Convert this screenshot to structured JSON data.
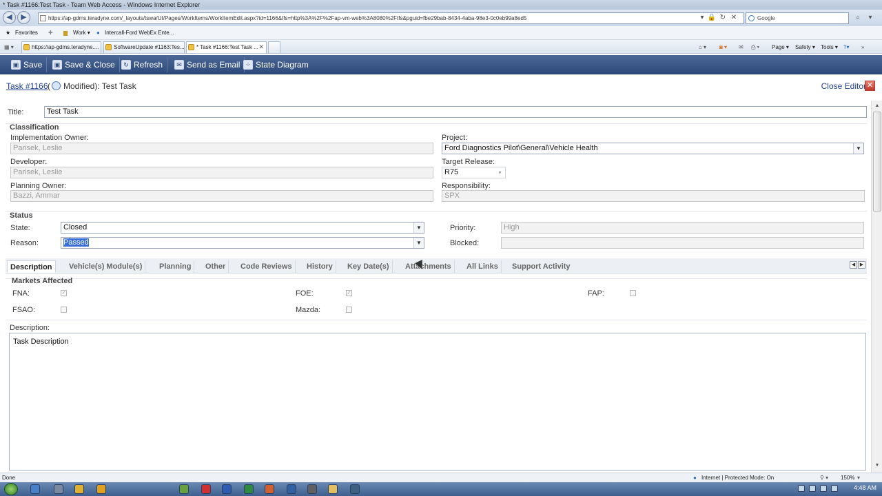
{
  "browser": {
    "window_title": "* Task #1166:Test Task - Team Web Access - Windows Internet Explorer",
    "address": "https://ap-gdms.teradyne.com/_layouts/tswa/UI/Pages/WorkItems/WorkItemEdit.aspx?id=1166&tfs=http%3A%2F%2Fap-vm-web%3A8080%2Ftfs&pguid=fbe29bab-8434-4aba-98e3-0c0eb99a8ed5",
    "search_placeholder": "Google",
    "favorites_label": "Favorites",
    "fav_items": [
      "Work ▾",
      "Intercall-Ford WebEx Ente..."
    ],
    "tabs": [
      {
        "label": "https://ap-gdms.teradyne...."
      },
      {
        "label": "SoftwareUpdate #1163:Tes..."
      },
      {
        "label": "* Task #1166:Test Task ..."
      }
    ],
    "command_bar": [
      "Page ▾",
      "Safety ▾",
      "Tools ▾"
    ],
    "status_left": "Done",
    "status_zone": "Internet | Protected Mode: On",
    "zoom": "150%",
    "clock": "4:48 AM"
  },
  "toolbar": {
    "save": "Save",
    "save_close": "Save & Close",
    "refresh": "Refresh",
    "send_email": "Send as Email",
    "state_diagram": "State Diagram"
  },
  "header": {
    "task_link": "Task #1166",
    "open_paren": "(",
    "rest": "Modified): Test Task",
    "close_editor": "Close Editor"
  },
  "form": {
    "title_label": "Title:",
    "title_value": "Test Task",
    "classification_heading": "Classification",
    "impl_owner_label": "Implementation Owner:",
    "impl_owner_value": "Parisek, Leslie",
    "developer_label": "Developer:",
    "developer_value": "Parisek, Leslie",
    "planning_owner_label": "Planning Owner:",
    "planning_owner_value": "Bazzi, Ammar",
    "project_label": "Project:",
    "project_value": "Ford Diagnostics Pilot\\General\\Vehicle Health",
    "target_release_label": "Target Release:",
    "target_release_value": "R75",
    "responsibility_label": "Responsibility:",
    "responsibility_value": "SPX",
    "status_heading": "Status",
    "state_label": "State:",
    "state_value": "Closed",
    "reason_label": "Reason:",
    "reason_value": "Passed",
    "priority_label": "Priority:",
    "priority_value": "High",
    "blocked_label": "Blocked:",
    "blocked_value": ""
  },
  "form_tabs": [
    "Description",
    "Vehicle(s) Module(s)",
    "Planning",
    "Other",
    "Code Reviews",
    "History",
    "Key Date(s)",
    "Attachments",
    "All Links",
    "Support Activity"
  ],
  "markets": {
    "heading": "Markets Affected",
    "fna_label": "FNA:",
    "fna_checked": true,
    "foe_label": "FOE:",
    "foe_checked": true,
    "fap_label": "FAP:",
    "fap_checked": false,
    "fsao_label": "FSAO:",
    "fsao_checked": false,
    "mazda_label": "Mazda:",
    "mazda_checked": false
  },
  "description": {
    "label": "Description:",
    "text": "Task Description"
  },
  "icons": {
    "check_mark": "✓",
    "dropdown": "▼"
  }
}
